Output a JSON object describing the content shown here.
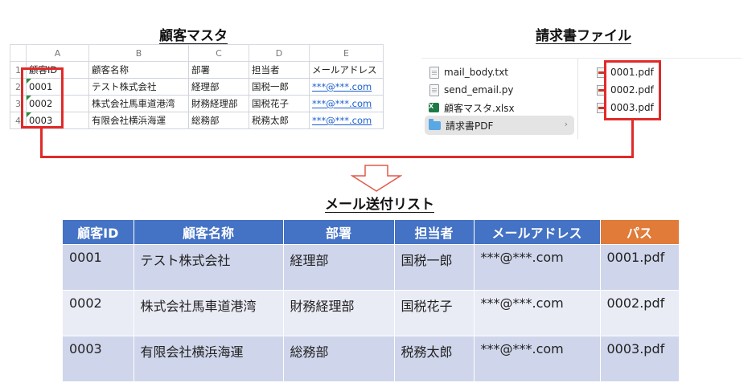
{
  "titles": {
    "customer_master": "顧客マスタ",
    "invoice_files": "請求書ファイル",
    "mail_list": "メール送付リスト"
  },
  "spreadsheet": {
    "column_letters": [
      "A",
      "B",
      "C",
      "D",
      "E"
    ],
    "header_row_number": "1",
    "headers": [
      "顧客ID",
      "顧客名称",
      "部署",
      "担当者",
      "メールアドレス"
    ],
    "rows": [
      {
        "num": "2",
        "id": "0001",
        "name": "テスト株式会社",
        "dept": "経理部",
        "person": "国税一郎",
        "email": "***@***.com"
      },
      {
        "num": "3",
        "id": "0002",
        "name": "株式会社馬車道港湾",
        "dept": "財務経理部",
        "person": "国税花子",
        "email": "***@***.com"
      },
      {
        "num": "4",
        "id": "0003",
        "name": "有限会社横浜海運",
        "dept": "総務部",
        "person": "税務太郎",
        "email": "***@***.com"
      }
    ]
  },
  "finder": {
    "left_items": [
      {
        "name": "mail_body.txt",
        "icon": "text-file-icon"
      },
      {
        "name": "send_email.py",
        "icon": "script-file-icon"
      },
      {
        "name": "顧客マスタ.xlsx",
        "icon": "excel-file-icon"
      },
      {
        "name": "請求書PDF",
        "icon": "folder-icon",
        "selected": true
      }
    ],
    "right_items": [
      "0001.pdf",
      "0002.pdf",
      "0003.pdf"
    ],
    "excel_icon_text": "X",
    "chevron": "›"
  },
  "mail_table": {
    "headers": [
      "顧客ID",
      "顧客名称",
      "部署",
      "担当者",
      "メールアドレス",
      "パス"
    ],
    "rows": [
      [
        "0001",
        "テスト株式会社",
        "経理部",
        "国税一郎",
        "***@***.com",
        "0001.pdf"
      ],
      [
        "0002",
        "株式会社馬車道港湾",
        "財務経理部",
        "国税花子",
        "***@***.com",
        "0002.pdf"
      ],
      [
        "0003",
        "有限会社横浜海運",
        "総務部",
        "税務太郎",
        "***@***.com",
        "0003.pdf"
      ]
    ]
  },
  "colors": {
    "highlight_red": "#e02a2a",
    "header_blue": "#4472c4",
    "header_orange": "#e07b39",
    "row_dark": "#cfd5ea",
    "row_light": "#e9ebf5",
    "link_blue": "#1a5fd0"
  }
}
